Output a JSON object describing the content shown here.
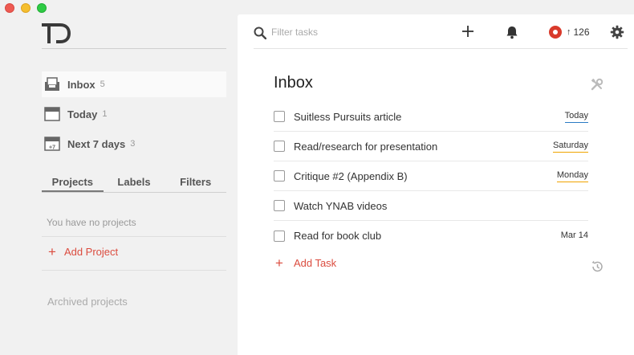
{
  "window": {
    "title": "Todoist"
  },
  "colors": {
    "accent": "#db4c3f",
    "today_underline": "#2b7bc4",
    "weekday_underline": "#f0a400"
  },
  "sidebar": {
    "logo_icon": "todoist-logo-icon",
    "nav": [
      {
        "label": "Inbox",
        "count": "5",
        "icon": "inbox-icon"
      },
      {
        "label": "Today",
        "count": "1",
        "icon": "calendar-icon"
      },
      {
        "label": "Next 7 days",
        "count": "3",
        "icon": "calendar-plus7-icon"
      }
    ],
    "tabs": [
      "Projects",
      "Labels",
      "Filters"
    ],
    "no_projects_text": "You have no projects",
    "add_project_label": "Add Project",
    "archived_label": "Archived projects"
  },
  "topbar": {
    "search_placeholder": "Filter tasks",
    "karma_arrow": "↑",
    "karma_count": "126"
  },
  "main": {
    "title": "Inbox",
    "tasks": [
      {
        "text": "Suitless Pursuits article",
        "due": "Today"
      },
      {
        "text": "Read/research for presentation",
        "due": "Saturday"
      },
      {
        "text": "Critique #2 (Appendix B)",
        "due": "Monday"
      },
      {
        "text": "Watch YNAB videos",
        "due": ""
      },
      {
        "text": "Read for book club",
        "due": "Mar 14"
      }
    ],
    "add_task_label": "Add Task"
  }
}
